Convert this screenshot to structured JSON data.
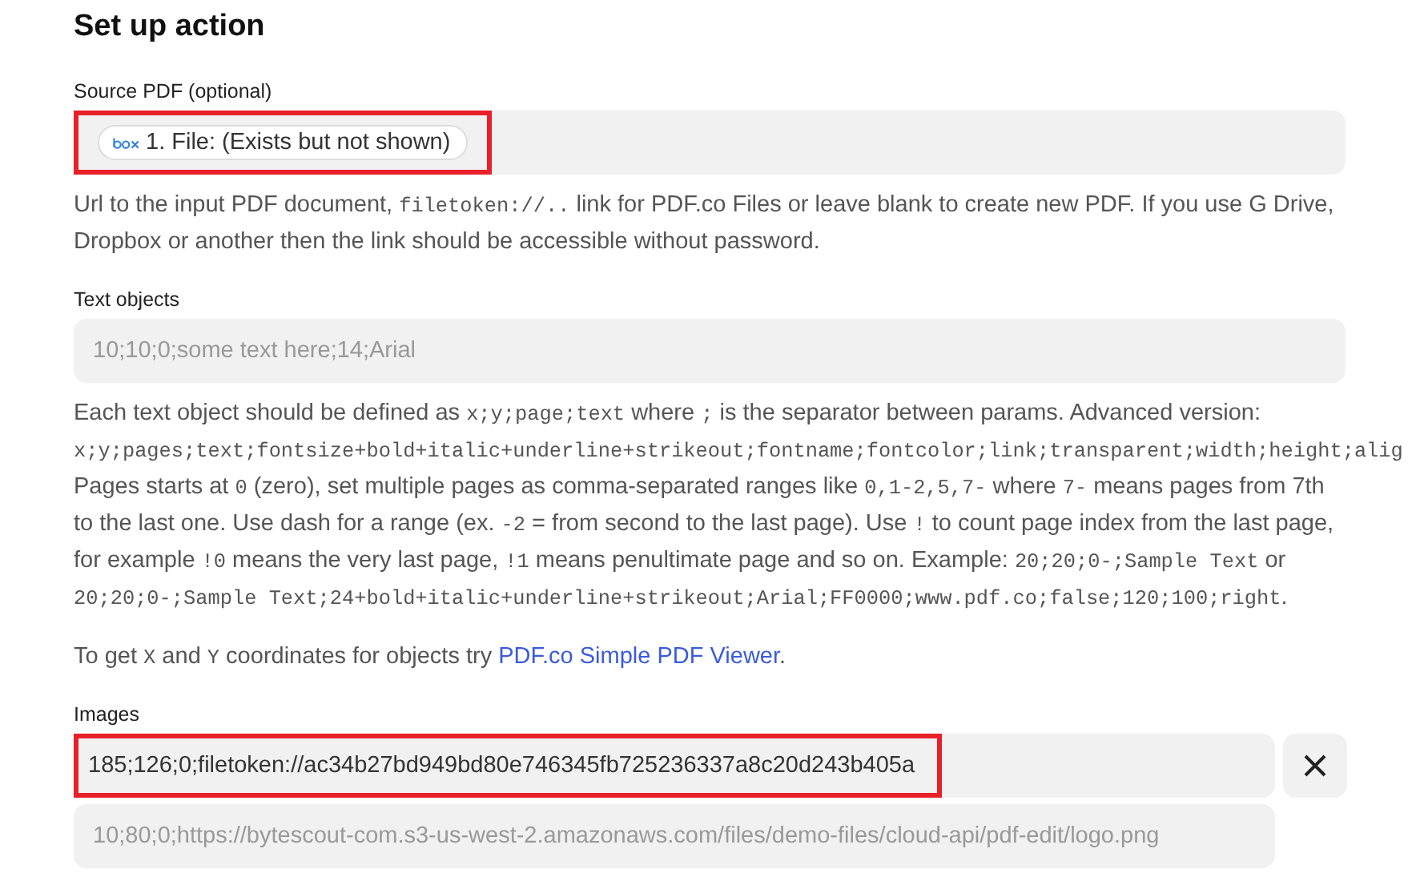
{
  "title": "Set up action",
  "sections": [
    {
      "kind": "chip",
      "label": "Source PDF (optional)",
      "highlighted": true,
      "chip": "1. File: (Exists but not shown)",
      "help": [
        [
          [
            {
              "kind": "text",
              "text": "Url to the input PDF document, "
            },
            {
              "kind": "code",
              "text": "filetoken://.."
            },
            {
              "kind": "text",
              "text": " link for PDF.co Files or leave blank to create new PDF. If you use G Drive,"
            }
          ],
          [
            {
              "kind": "text",
              "text": "Dropbox or another then the link should be accessible without password."
            }
          ]
        ]
      ]
    },
    {
      "kind": "text",
      "label": "Text objects",
      "placeholder": "10;10;0;some text here;14;Arial",
      "help": [
        [
          [
            {
              "kind": "text",
              "text": "Each text object should be defined as "
            },
            {
              "kind": "code",
              "text": "x;y;page;text"
            },
            {
              "kind": "text",
              "text": " where "
            },
            {
              "kind": "code",
              "text": ";"
            },
            {
              "kind": "text",
              "text": " is the separator between params. Advanced version:"
            }
          ],
          [
            {
              "kind": "code",
              "text": "x;y;pages;text;fontsize+bold+italic+underline+strikeout;fontname;fontcolor;link;transparent;width;height;alig"
            }
          ],
          [
            {
              "kind": "text",
              "text": "Pages starts at "
            },
            {
              "kind": "code",
              "text": "0"
            },
            {
              "kind": "text",
              "text": " (zero), set multiple pages as comma-separated ranges like "
            },
            {
              "kind": "code",
              "text": "0,1-2,5,7-"
            },
            {
              "kind": "text",
              "text": " where "
            },
            {
              "kind": "code",
              "text": "7-"
            },
            {
              "kind": "text",
              "text": " means pages from 7th"
            }
          ],
          [
            {
              "kind": "text",
              "text": "to the last one. Use dash for a range (ex. "
            },
            {
              "kind": "code",
              "text": "-2"
            },
            {
              "kind": "text",
              "text": " = from second to the last page). Use "
            },
            {
              "kind": "code",
              "text": "!"
            },
            {
              "kind": "text",
              "text": " to count page index from the last page,"
            }
          ],
          [
            {
              "kind": "text",
              "text": "for example "
            },
            {
              "kind": "code",
              "text": "!0"
            },
            {
              "kind": "text",
              "text": " means the very last page, "
            },
            {
              "kind": "code",
              "text": "!1"
            },
            {
              "kind": "text",
              "text": " means penultimate page and so on. Example: "
            },
            {
              "kind": "code",
              "text": "20;20;0-;Sample Text"
            },
            {
              "kind": "text",
              "text": " or"
            }
          ],
          [
            {
              "kind": "code",
              "text": "20;20;0-;Sample Text;24+bold+italic+underline+strikeout;Arial;FF0000;www.pdf.co;false;120;100;right"
            },
            {
              "kind": "text",
              "text": "."
            }
          ]
        ],
        [
          [
            {
              "kind": "text",
              "text": "To get "
            },
            {
              "kind": "code",
              "text": "X"
            },
            {
              "kind": "text",
              "text": " and "
            },
            {
              "kind": "code",
              "text": "Y"
            },
            {
              "kind": "text",
              "text": " coordinates for objects try "
            },
            {
              "kind": "link",
              "text": "PDF.co Simple PDF Viewer"
            },
            {
              "kind": "text",
              "text": "."
            }
          ]
        ]
      ]
    },
    {
      "kind": "list",
      "label": "Images",
      "items": [
        {
          "value": "185;126;0;filetoken://ac34b27bd949bd80e746345fb725236337a8c20d243b405a",
          "highlighted": true,
          "removable": true
        }
      ],
      "placeholder": "10;80;0;https://bytescout-com.s3-us-west-2.amazonaws.com/files/demo-files/cloud-api/pdf-edit/logo.png"
    }
  ]
}
